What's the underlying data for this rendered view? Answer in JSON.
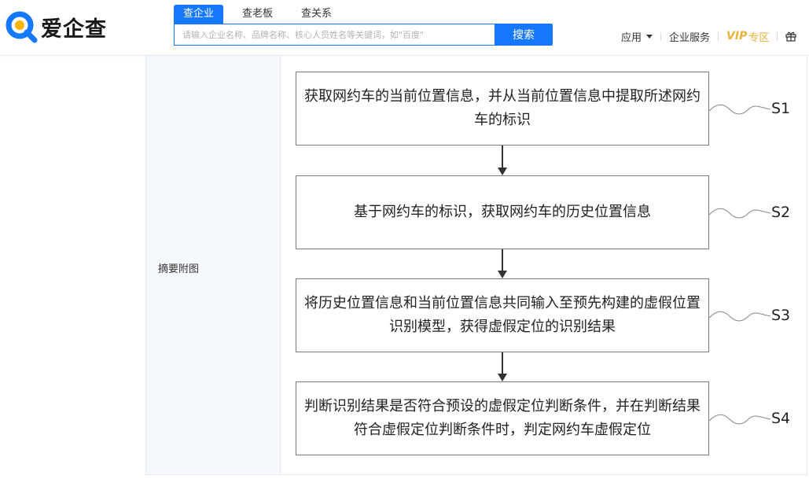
{
  "header": {
    "logo_text": "爱企查",
    "tabs": [
      {
        "label": "查企业",
        "active": true
      },
      {
        "label": "查老板",
        "active": false
      },
      {
        "label": "查关系",
        "active": false
      }
    ],
    "search": {
      "placeholder": "请输入企业名称、品牌名称、核心人员姓名等关键词，如\"百度\"",
      "value": "",
      "button_label": "搜索"
    },
    "nav": {
      "apps_label": "应用",
      "enterprise_service_label": "企业服务",
      "vip_label": "VIP",
      "vip_sub_label": "专区"
    }
  },
  "content": {
    "row_label": "摘要附图",
    "flowchart": {
      "steps": [
        {
          "id": "S1",
          "text": "获取网约车的当前位置信息，并从当前位置信息中提取所述网约车的标识"
        },
        {
          "id": "S2",
          "text": "基于网约车的标识，获取网约车的历史位置信息"
        },
        {
          "id": "S3",
          "text": "将历史位置信息和当前位置信息共同输入至预先构建的虚假位置识别模型，获得虚假定位的识别结果"
        },
        {
          "id": "S4",
          "text": "判断识别结果是否符合预设的虚假定位判断条件，并在判断结果符合虚假定位判断条件时，判定网约车虚假定位"
        }
      ]
    }
  },
  "colors": {
    "brand_blue": "#1677ff",
    "vip_gold": "#e8b33a",
    "label_bg": "#f5f8fd"
  }
}
